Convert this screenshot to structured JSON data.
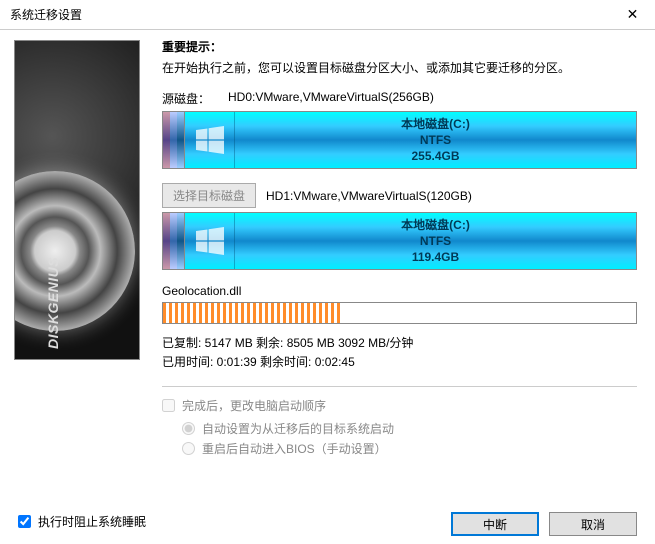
{
  "window": {
    "title": "系统迁移设置"
  },
  "hint": {
    "title": "重要提示：",
    "text": "在开始执行之前，您可以设置目标磁盘分区大小、或添加其它要迁移的分区。"
  },
  "source": {
    "label": "源磁盘：",
    "name": "HD0:VMware,VMwareVirtualS(256GB)",
    "part_name": "本地磁盘(C:)",
    "fs": "NTFS",
    "size": "255.4GB"
  },
  "target": {
    "select_label": "选择目标磁盘",
    "name": "HD1:VMware,VMwareVirtualS(120GB)",
    "part_name": "本地磁盘(C:)",
    "fs": "NTFS",
    "size": "119.4GB"
  },
  "progress": {
    "file": "Geolocation.dll",
    "percent": 38,
    "line1": "已复制:   5147 MB   剩余:   8505 MB   3092 MB/分钟",
    "line2": "已用时间:   0:01:39   剩余时间:   0:02:45"
  },
  "options": {
    "change_boot": "完成后，更改电脑启动顺序",
    "auto_target": "自动设置为从迁移后的目标系统启动",
    "reboot_bios": "重启后自动进入BIOS（手动设置）"
  },
  "footer": {
    "prevent_sleep": "执行时阻止系统睡眠",
    "abort": "中断",
    "cancel": "取消"
  },
  "sidebar_brand": "DISKGENIUS"
}
